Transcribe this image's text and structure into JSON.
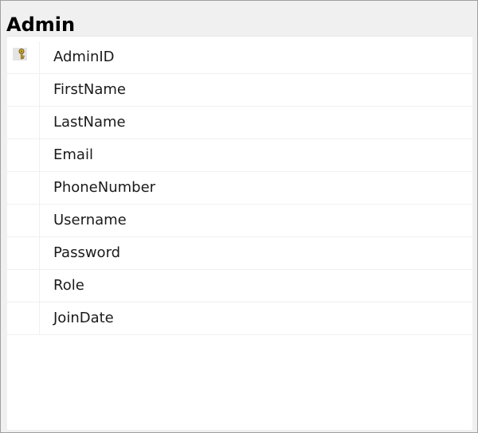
{
  "table": {
    "title": "Admin",
    "columns": [
      {
        "name": "AdminID",
        "primary_key": true
      },
      {
        "name": "FirstName",
        "primary_key": false
      },
      {
        "name": "LastName",
        "primary_key": false
      },
      {
        "name": "Email",
        "primary_key": false
      },
      {
        "name": "PhoneNumber",
        "primary_key": false
      },
      {
        "name": "Username",
        "primary_key": false
      },
      {
        "name": "Password",
        "primary_key": false
      },
      {
        "name": "Role",
        "primary_key": false
      },
      {
        "name": "JoinDate",
        "primary_key": false
      }
    ]
  },
  "icons": {
    "primary_key": "key-icon"
  },
  "colors": {
    "key_gold": "#d8b23a",
    "key_outline": "#6b5a12",
    "key_badge_bg": "#e4e4e4"
  }
}
